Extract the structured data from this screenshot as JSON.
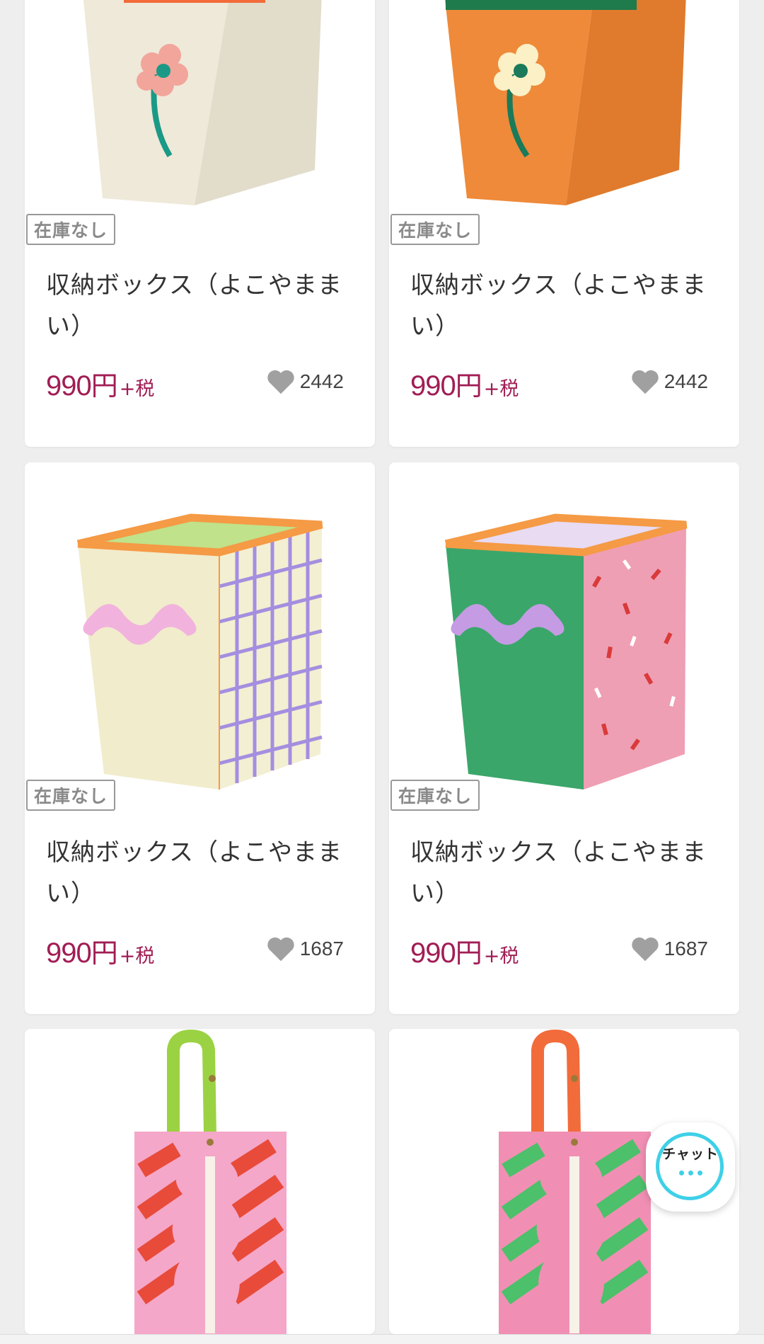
{
  "products": [
    {
      "badge": "在庫なし",
      "title": "収納ボックス（よこやまま い）",
      "price": "990",
      "currency": "円",
      "tax": "+税",
      "likes": "2442",
      "image": "flower-storage-box-cream"
    },
    {
      "badge": "在庫なし",
      "title": "収納ボックス（よこやまま い）",
      "price": "990",
      "currency": "円",
      "tax": "+税",
      "likes": "2442",
      "image": "flower-storage-box-orange"
    },
    {
      "badge": "在庫なし",
      "title": "収納ボックス（よこやまま い）",
      "price": "990",
      "currency": "円",
      "tax": "+税",
      "likes": "1687",
      "image": "wave-storage-box-yellow-grid"
    },
    {
      "badge": "在庫なし",
      "title": "収納ボックス（よこやまま い）",
      "price": "990",
      "currency": "円",
      "tax": "+税",
      "likes": "1687",
      "image": "wave-storage-box-green-pink"
    },
    {
      "image": "tissue-case-pink-red-stripe"
    },
    {
      "image": "tissue-case-pink-green-stripe"
    }
  ],
  "chat": {
    "label": "チャット",
    "icon": "chat-bubble-icon",
    "accent": "#3fd0e8"
  },
  "colors": {
    "price": "#a11d55",
    "badge_border": "#999999",
    "heart": "#a0a0a0"
  }
}
